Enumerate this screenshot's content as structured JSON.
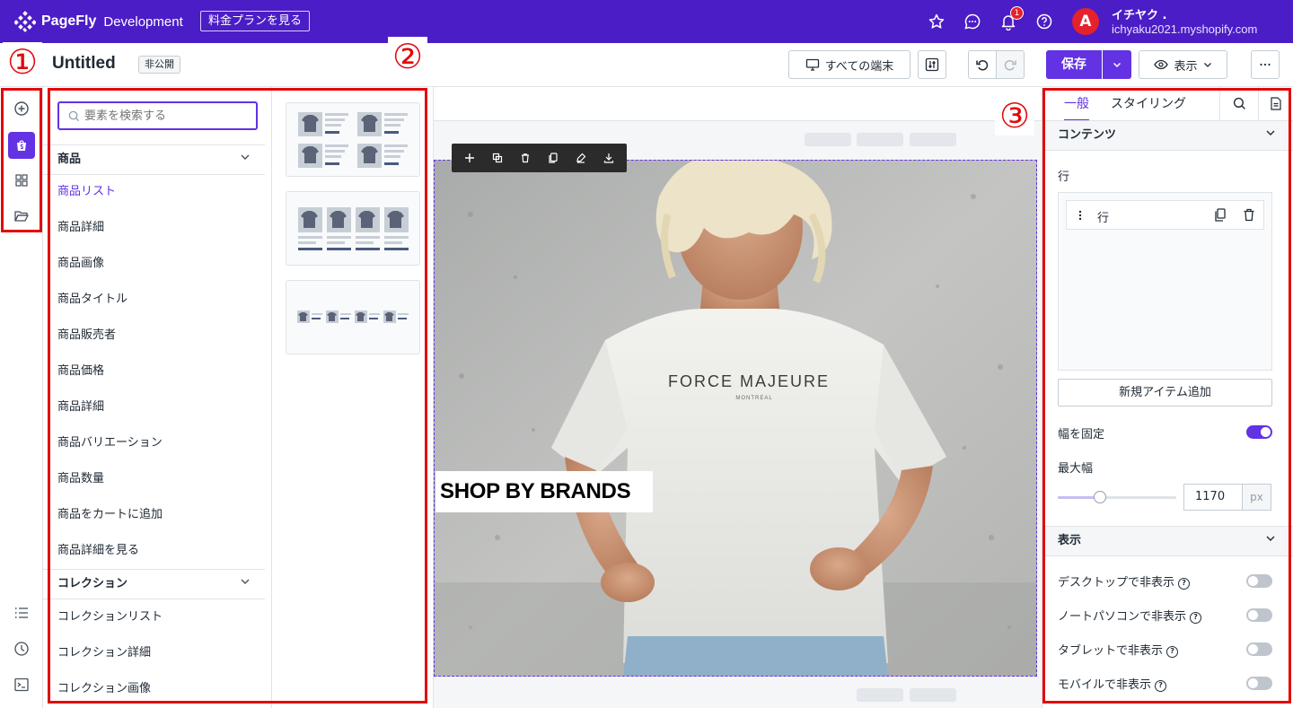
{
  "topbar": {
    "brand": "PageFly",
    "environment": "Development",
    "plan_button": "料金プランを見る",
    "notification_count": "1",
    "avatar_letter": "A",
    "user_name": "イチヤク .",
    "store": "ichyaku2021.myshopify.com",
    "icons": [
      "star-icon",
      "chat-icon",
      "bell-icon",
      "help-icon"
    ]
  },
  "toolbar": {
    "page_title": "Untitled",
    "visibility": "非公開",
    "device_label": "すべての端末",
    "save_label": "保存",
    "preview_label": "表示"
  },
  "search": {
    "placeholder": "要素を検索する"
  },
  "groups": [
    {
      "title": "商品",
      "items": [
        "商品リスト",
        "商品詳細",
        "商品画像",
        "商品タイトル",
        "商品販売者",
        "商品価格",
        "商品詳細",
        "商品バリエーション",
        "商品数量",
        "商品をカートに追加",
        "商品詳細を見る"
      ]
    },
    {
      "title": "コレクション",
      "items": [
        "コレクションリスト",
        "コレクション詳細",
        "コレクション画像"
      ]
    }
  ],
  "canvas": {
    "hero_text": "SHOP BY BRANDS",
    "shirt_text": "FORCE MAJEURE",
    "shirt_subtext": "MONTREAL"
  },
  "settings": {
    "tabs": [
      "一般",
      "スタイリング"
    ],
    "content_section": "コンテンツ",
    "row_label": "行",
    "row_item": "行",
    "add_item": "新規アイテム追加",
    "fixed_width_label": "幅を固定",
    "fixed_width": true,
    "max_width_label": "最大幅",
    "max_width_value": "1170",
    "max_width_unit": "px",
    "display_section": "表示",
    "hide_options": [
      {
        "label": "デスクトップで非表示",
        "on": false
      },
      {
        "label": "ノートパソコンで非表示",
        "on": false
      },
      {
        "label": "タブレットで非表示",
        "on": false
      },
      {
        "label": "モバイルで非表示",
        "on": false
      }
    ]
  },
  "annotations": [
    "①",
    "②",
    "③"
  ],
  "colors": {
    "brand_purple": "#4b1dc6",
    "accent": "#6232e3",
    "annotation_red": "#e3070a"
  }
}
